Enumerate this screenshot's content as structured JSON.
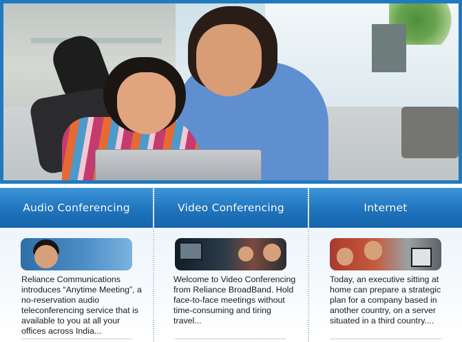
{
  "hero": {
    "image": "mother-and-daughter-using-laptop-photo"
  },
  "panels": [
    {
      "title": "Audio Conferencing",
      "thumbnail": "woman-on-phone-thumbnail",
      "text": "Reliance Communications introduces “Anytime Meeting”, a no-reservation audio teleconferencing service that is available to you at all your offices across India..."
    },
    {
      "title": "Video Conferencing",
      "thumbnail": "video-meeting-thumbnail",
      "text": "Welcome to Video Conferencing from Reliance BroadBand. Hold face-to-face meetings without time-consuming and tiring travel..."
    },
    {
      "title": "Internet",
      "thumbnail": "family-at-computer-thumbnail",
      "text": "Today, an executive sitting at home can prepare a strategic plan for a company based in another country, on a server situated in a third country...."
    }
  ],
  "colors": {
    "frame_blue": "#1f7ac0",
    "header_blue": "#1f74bd"
  }
}
